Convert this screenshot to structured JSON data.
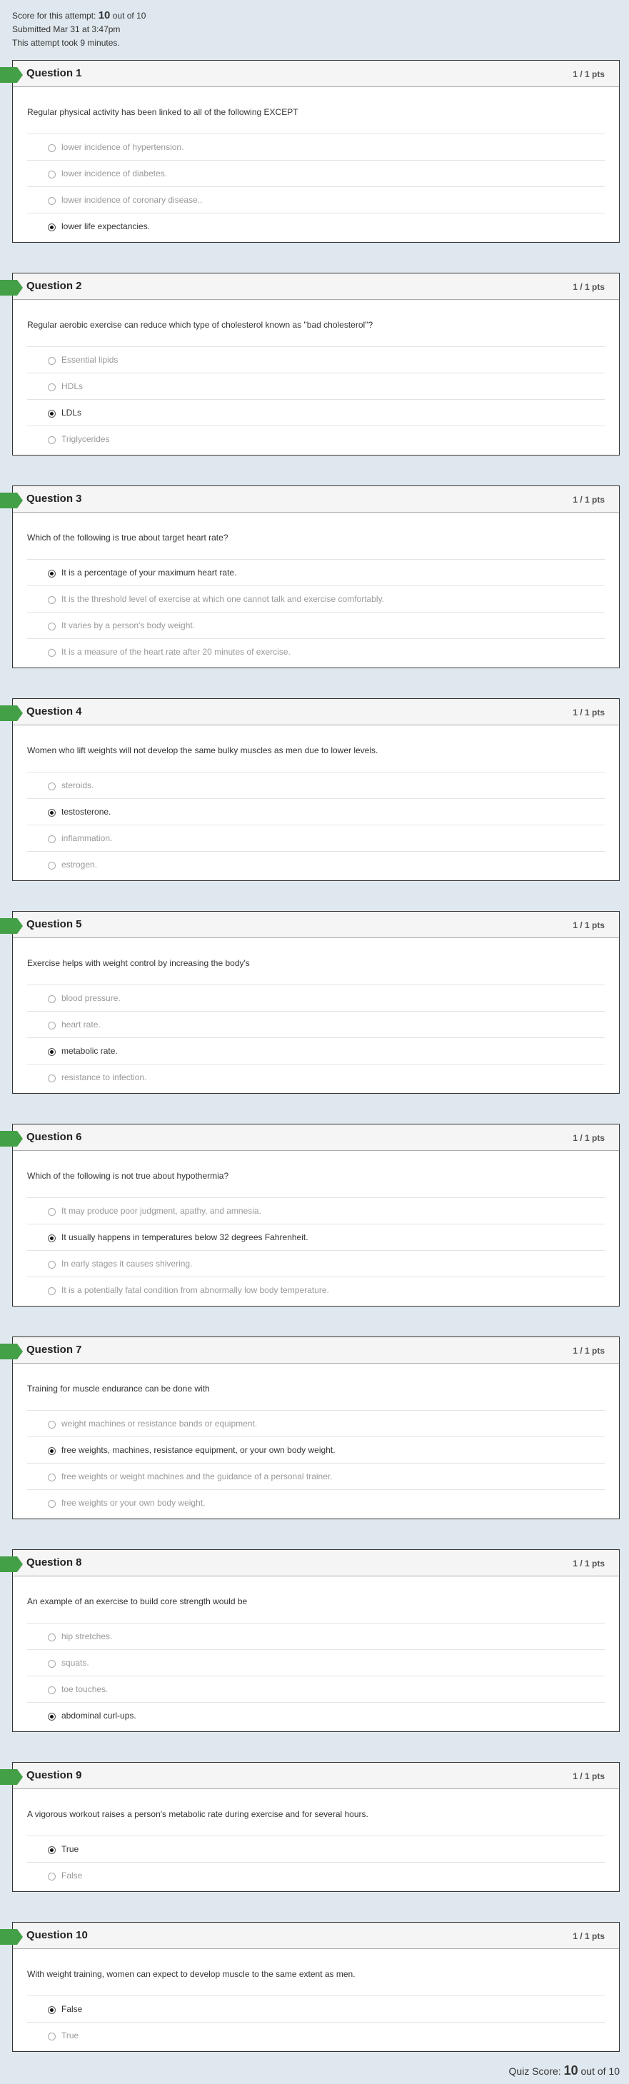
{
  "summary": {
    "score_prefix": "Score for this attempt: ",
    "score": "10",
    "score_suffix": " out of 10",
    "submitted": "Submitted Mar 31 at 3:47pm",
    "duration": "This attempt took 9 minutes."
  },
  "questions": [
    {
      "title": "Question 1",
      "pts": "1 / 1 pts",
      "text": "Regular physical activity has been linked to all of the following EXCEPT",
      "options": [
        "lower incidence of hypertension.",
        "lower incidence of diabetes.",
        "lower incidence of coronary disease..",
        "lower life expectancies."
      ],
      "selected": 3
    },
    {
      "title": "Question 2",
      "pts": "1 / 1 pts",
      "text": "Regular aerobic exercise can reduce which type of cholesterol known as \"bad cholesterol\"?",
      "options": [
        "Essential lipids",
        "HDLs",
        "LDLs",
        "Triglycerides"
      ],
      "selected": 2
    },
    {
      "title": "Question 3",
      "pts": "1 / 1 pts",
      "text": "Which of the following is true about target heart rate?",
      "options": [
        "It is a percentage of your maximum heart rate.",
        "It is the threshold level of exercise at which one cannot talk and exercise comfortably.",
        "It varies by a person's body weight.",
        "It is a measure of the heart rate after 20 minutes of exercise."
      ],
      "selected": 0
    },
    {
      "title": "Question 4",
      "pts": "1 / 1 pts",
      "text": "Women who lift weights will not develop the same bulky muscles as men due to lower levels.",
      "options": [
        "steroids.",
        "testosterone.",
        "inflammation.",
        "estrogen."
      ],
      "selected": 1
    },
    {
      "title": "Question 5",
      "pts": "1 / 1 pts",
      "text": "Exercise helps with weight control by increasing the body's",
      "options": [
        "blood pressure.",
        "heart rate.",
        "metabolic rate.",
        "resistance to infection."
      ],
      "selected": 2
    },
    {
      "title": "Question 6",
      "pts": "1 / 1 pts",
      "text": "Which of the following is not true about hypothermia?",
      "options": [
        "It may produce poor judgment, apathy, and amnesia.",
        "It usually happens in temperatures below 32 degrees Fahrenheit.",
        "In early stages it causes shivering.",
        "It is a potentially fatal condition from abnormally low body temperature."
      ],
      "selected": 1
    },
    {
      "title": "Question 7",
      "pts": "1 / 1 pts",
      "text": "Training for muscle endurance can be done with",
      "options": [
        "weight machines or resistance bands or equipment.",
        "free weights, machines, resistance equipment, or your own body weight.",
        "free weights or weight machines and the guidance of a personal trainer.",
        "free weights or your own body weight."
      ],
      "selected": 1
    },
    {
      "title": "Question 8",
      "pts": "1 / 1 pts",
      "text": "An example of an exercise to build core strength would be",
      "options": [
        "hip stretches.",
        "squats.",
        "toe touches.",
        "abdominal curl-ups."
      ],
      "selected": 3
    },
    {
      "title": "Question 9",
      "pts": "1 / 1 pts",
      "text": "A vigorous workout raises a person's metabolic rate during exercise and for several hours.",
      "options": [
        "True",
        "False"
      ],
      "selected": 0
    },
    {
      "title": "Question 10",
      "pts": "1 / 1 pts",
      "text": "With weight training, women can expect to develop muscle to the same extent as men.",
      "options": [
        "False",
        "True"
      ],
      "selected": 0
    }
  ],
  "final": {
    "prefix": "Quiz Score: ",
    "score": "10",
    "suffix": " out of 10"
  },
  "colors": {
    "background": "#dfe8ee",
    "flag": "#43a047"
  }
}
